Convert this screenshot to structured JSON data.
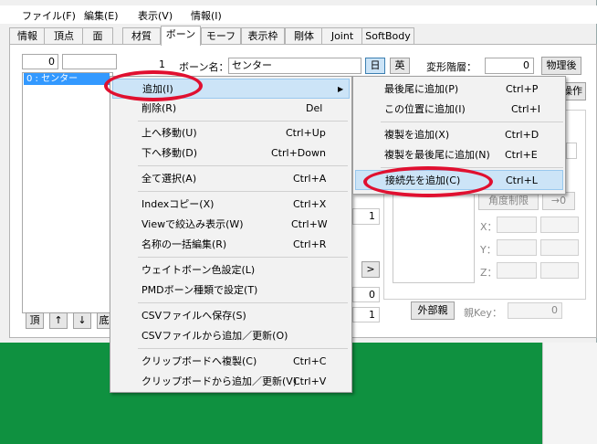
{
  "menubar": [
    "ファイル(F)",
    "編集(E)",
    "表示(V)",
    "情報(I)"
  ],
  "tabs": [
    "情報",
    "頂点",
    "面",
    "材質",
    "ボーン",
    "モーフ",
    "表示枠",
    "剛体",
    "Joint",
    "SoftBody"
  ],
  "active_tab": "ボーン",
  "bone_index_value": "0",
  "bone_number": "1",
  "bone_name_label": "ボーン名：",
  "bone_name_value": "センター",
  "lang_jp": "日",
  "lang_en": "英",
  "deform_label": "変形階層：",
  "deform_value": "0",
  "after_physics": "物理後",
  "list_selected": "0 : センター",
  "partial_operate": "操作",
  "angle_limit": "角度制限",
  "arrow_zero": "→0",
  "coord_x": "X：",
  "coord_y": "Y：",
  "coord_z": "Z：",
  "left_value_1": "1",
  "left_value_2": "0",
  "left_value_3": "1",
  "arrow_right": ">",
  "external_parent": "外部親",
  "parent_key_label": "親Key：",
  "parent_key_value": "0",
  "bottom_buttons": [
    "頂",
    "↑",
    "↓",
    "底"
  ],
  "context_menu": [
    {
      "label": "追加(I)",
      "shortcut": "▶"
    },
    {
      "label": "削除(R)",
      "shortcut": "Del"
    },
    {
      "label": "上へ移動(U)",
      "shortcut": "Ctrl+Up"
    },
    {
      "label": "下へ移動(D)",
      "shortcut": "Ctrl+Down"
    },
    {
      "label": "全て選択(A)",
      "shortcut": "Ctrl+A"
    },
    {
      "label": "Indexコピー(X)",
      "shortcut": "Ctrl+X"
    },
    {
      "label": "Viewで絞込み表示(W)",
      "shortcut": "Ctrl+W"
    },
    {
      "label": "名称の一括編集(R)",
      "shortcut": "Ctrl+R"
    },
    {
      "label": "ウェイトボーン色設定(L)",
      "shortcut": ""
    },
    {
      "label": "PMDボーン種類で設定(T)",
      "shortcut": ""
    },
    {
      "label": "CSVファイルへ保存(S)",
      "shortcut": ""
    },
    {
      "label": "CSVファイルから追加／更新(O)",
      "shortcut": ""
    },
    {
      "label": "クリップボードへ複製(C)",
      "shortcut": "Ctrl+C"
    },
    {
      "label": "クリップボードから追加／更新(V)",
      "shortcut": "Ctrl+V"
    }
  ],
  "submenu": [
    {
      "label": "最後尾に追加(P)",
      "shortcut": "Ctrl+P"
    },
    {
      "label": "この位置に追加(I)",
      "shortcut": "Ctrl+I"
    },
    {
      "label": "複製を追加(X)",
      "shortcut": "Ctrl+D"
    },
    {
      "label": "複製を最後尾に追加(N)",
      "shortcut": "Ctrl+E"
    },
    {
      "label": "接続先を追加(C)",
      "shortcut": "Ctrl+L"
    }
  ],
  "colors": {
    "highlight": "#cce4f7",
    "annotation_ring": "#e01030",
    "desktop_green": "#0f9140",
    "list_selection": "#3399ff"
  }
}
